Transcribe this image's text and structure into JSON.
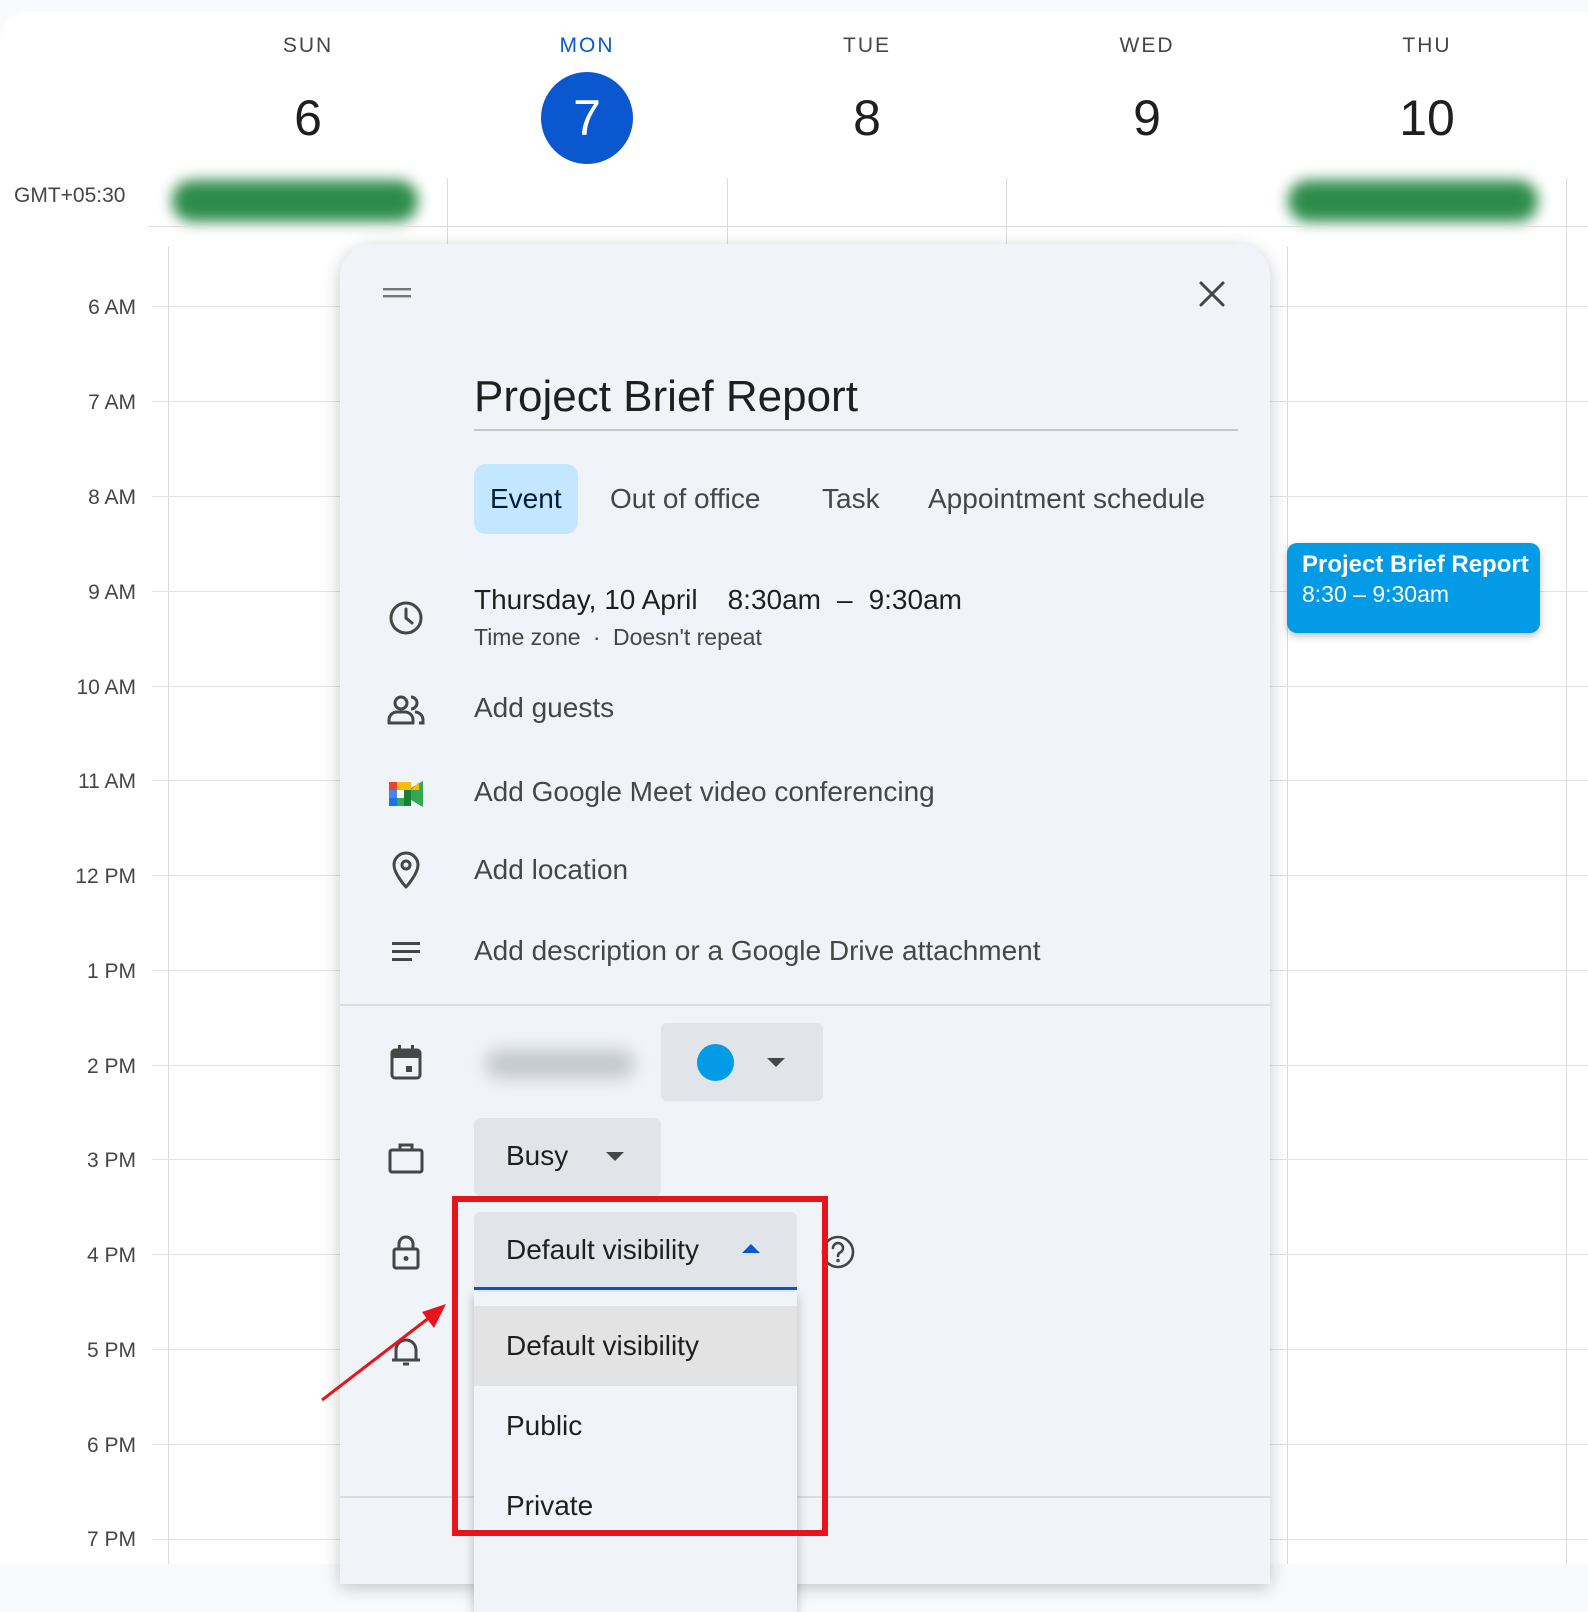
{
  "calendar": {
    "timezone": "GMT+05:30",
    "days": [
      {
        "name": "SUN",
        "num": "6"
      },
      {
        "name": "MON",
        "num": "7",
        "today": true
      },
      {
        "name": "TUE",
        "num": "8"
      },
      {
        "name": "WED",
        "num": "9"
      },
      {
        "name": "THU",
        "num": "10"
      }
    ],
    "hours": [
      "6 AM",
      "7 AM",
      "8 AM",
      "9 AM",
      "10 AM",
      "11 AM",
      "12 PM",
      "1 PM",
      "2 PM",
      "3 PM",
      "4 PM",
      "5 PM",
      "6 PM",
      "7 PM"
    ],
    "event_chip": {
      "title": "Project Brief Report",
      "time": "8:30 – 9:30am",
      "color": "#039be5"
    }
  },
  "dialog": {
    "title": "Project Brief Report",
    "tabs": [
      "Event",
      "Out of office",
      "Task",
      "Appointment schedule"
    ],
    "active_tab": "Event",
    "date": "Thursday, 10 April",
    "start": "8:30am",
    "dash": "–",
    "end": "9:30am",
    "timezone_link": "Time zone",
    "bullet": "·",
    "repeat": "Doesn't repeat",
    "add_guests": "Add guests",
    "add_meet": "Add Google Meet video conferencing",
    "add_location": "Add location",
    "add_description": "Add description or a Google Drive attachment",
    "event_color": "#039be5",
    "availability": "Busy",
    "visibility": {
      "selected": "Default visibility",
      "options": [
        "Default visibility",
        "Public",
        "Private"
      ]
    }
  },
  "icons": {
    "drag": "drag-handle-icon",
    "close": "close-icon",
    "clock": "clock-icon",
    "guests": "people-icon",
    "meet": "google-meet-icon",
    "location": "location-pin-icon",
    "description": "notes-icon",
    "calendar": "calendar-icon",
    "availability": "briefcase-icon",
    "visibility": "lock-icon",
    "notification": "bell-icon",
    "help": "help-icon"
  },
  "annotation": {
    "highlight_color": "#e8141c"
  }
}
